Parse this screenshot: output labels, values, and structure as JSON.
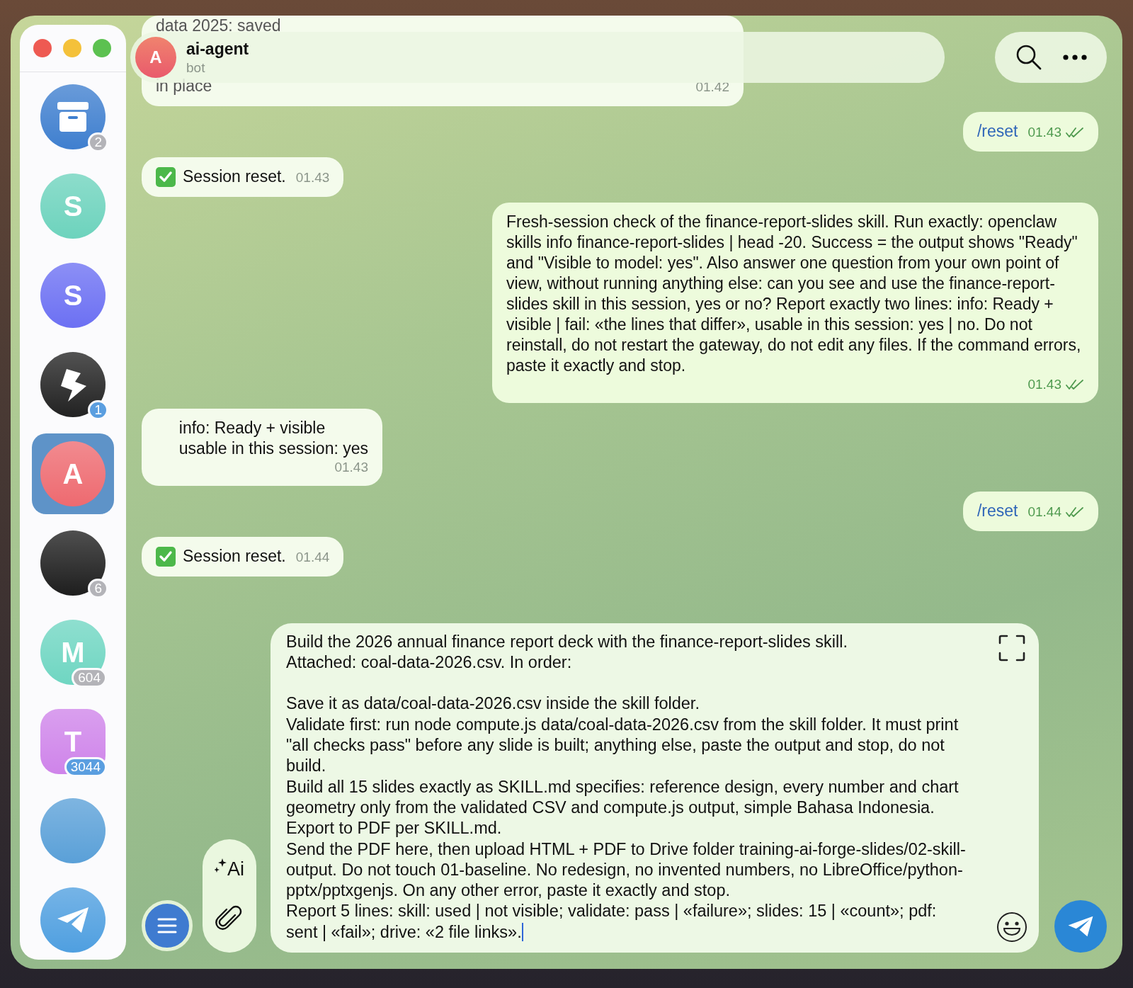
{
  "sidebar": {
    "items": [
      {
        "kind": "archive",
        "color": "#3f7fcf",
        "badge": "2",
        "muted": true,
        "selected": false
      },
      {
        "kind": "letter",
        "letter": "S",
        "color": "#6dd3bd",
        "selected": false
      },
      {
        "kind": "letter",
        "letter": "S",
        "color": "#6c70f3",
        "selected": false
      },
      {
        "kind": "mark",
        "color": "#222222",
        "badge": "1",
        "muted": false,
        "selected": false
      },
      {
        "kind": "letter",
        "letter": "A",
        "color": "#ee6a70",
        "selected": true
      },
      {
        "kind": "photo",
        "color": "#1e1e1e",
        "badge": "6",
        "muted": true,
        "selected": false
      },
      {
        "kind": "letter",
        "letter": "M",
        "color": "#6fd6c2",
        "badge": "604",
        "muted": true,
        "selected": false
      },
      {
        "kind": "forum",
        "letter": "T",
        "color": "#cf84ea",
        "badge": "3044",
        "muted": false,
        "selected": false
      },
      {
        "kind": "photo",
        "color": "#5aa0d8",
        "selected": false
      },
      {
        "kind": "plane",
        "color": "#4f9fe0",
        "selected": false
      }
    ]
  },
  "header": {
    "avatar_letter": "A",
    "title": "ai-agent",
    "subtitle": "bot"
  },
  "messages": [
    {
      "outgoing": false,
      "kind": "partial",
      "lines": [
        "data 2025: saved",
        "in place"
      ],
      "time": "01.42"
    },
    {
      "outgoing": true,
      "kind": "command",
      "text": "/reset",
      "time": "01.43"
    },
    {
      "outgoing": false,
      "kind": "status",
      "text": "Session reset.",
      "time": "01.43"
    },
    {
      "outgoing": true,
      "kind": "text",
      "text": "Fresh-session check of the finance-report-slides skill. Run exactly: openclaw skills info finance-report-slides | head -20. Success = the output shows \"Ready\" and \"Visible to model: yes\". Also answer one question from your own point of view, without running anything else: can you see and use the finance-report-slides skill in this session, yes or no? Report exactly two lines: info: Ready + visible | fail: «the lines that differ», usable in this session: yes | no. Do not reinstall, do not restart the gateway, do not edit any files. If the command errors, paste it exactly and stop.",
      "time": "01.43"
    },
    {
      "outgoing": false,
      "kind": "text",
      "text": "info: Ready + visible\nusable in this session: yes",
      "time": "01.43"
    },
    {
      "outgoing": true,
      "kind": "command",
      "text": "/reset",
      "time": "01.44"
    },
    {
      "outgoing": false,
      "kind": "status",
      "text": "Session reset.",
      "time": "01.44"
    }
  ],
  "composer": {
    "ai_label": "Ai",
    "value": "Build the 2026 annual finance report deck with the finance-report-slides skill.\nAttached: coal-data-2026.csv. In order:\n\nSave it as data/coal-data-2026.csv inside the skill folder.\nValidate first: run node compute.js data/coal-data-2026.csv from the skill folder. It must print \"all checks pass\" before any slide is built; anything else, paste the output and stop, do not build.\nBuild all 15 slides exactly as SKILL.md specifies: reference design, every number and chart geometry only from the validated CSV and compute.js output, simple Bahasa Indonesia.\nExport to PDF per SKILL.md.\nSend the PDF here, then upload HTML + PDF to Drive folder training-ai-forge-slides/02-skill-output. Do not touch 01-baseline. No redesign, no invented numbers, no LibreOffice/python-pptx/pptxgenjs. On any other error, paste it exactly and stop.\nReport 5 lines: skill: used | not visible; validate: pass | «failure»; slides: 15 | «count»; pdf: sent | «fail»; drive: «2 file links»."
  }
}
